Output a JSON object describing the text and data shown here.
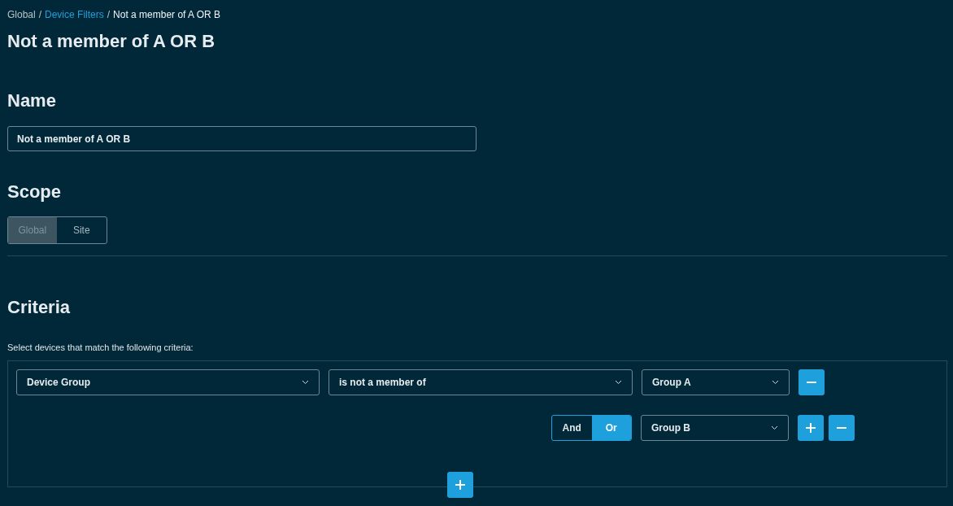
{
  "breadcrumb_separator": "/",
  "breadcrumb": [
    {
      "label": "Global",
      "kind": "text"
    },
    {
      "label": "Device Filters",
      "kind": "link"
    },
    {
      "label": "Not a member of A OR B",
      "kind": "current"
    }
  ],
  "title": "Not a member of A OR B",
  "name_section": {
    "heading": "Name",
    "value": "Not a member of A OR B"
  },
  "scope_section": {
    "heading": "Scope",
    "options": [
      {
        "label": "Global",
        "selected": true
      },
      {
        "label": "Site",
        "selected": false
      }
    ]
  },
  "criteria_section": {
    "heading": "Criteria",
    "description": "Select devices that match the following criteria:",
    "rows": [
      {
        "kind": "condition",
        "field": "Device Group",
        "operator": "is not a member of",
        "value": "Group A",
        "buttons": [
          {
            "kind": "remove"
          }
        ]
      },
      {
        "kind": "join",
        "connectors": [
          {
            "label": "And",
            "selected": false
          },
          {
            "label": "Or",
            "selected": true
          }
        ],
        "value": "Group B",
        "buttons": [
          {
            "kind": "add"
          },
          {
            "kind": "remove"
          }
        ]
      }
    ]
  }
}
